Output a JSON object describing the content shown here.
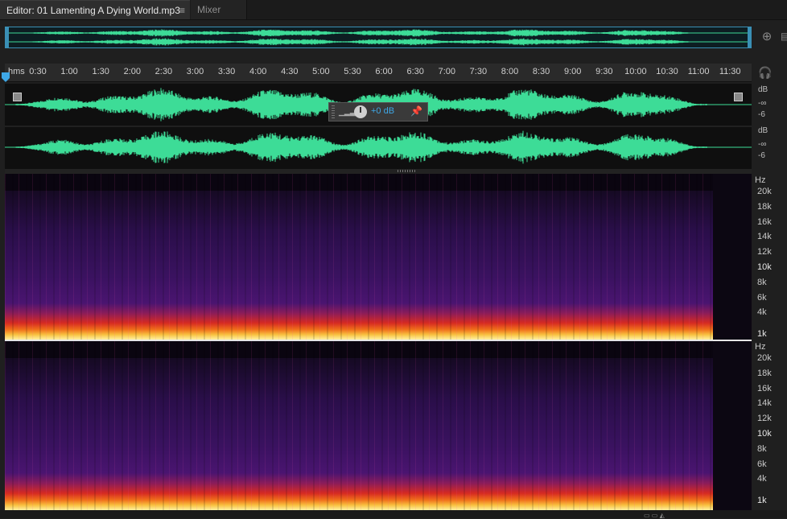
{
  "tabs": {
    "editor_label": "Editor: 01 Lamenting A Dying World.mp3",
    "editor_menu": "≡",
    "mixer_label": "Mixer"
  },
  "colors": {
    "waveform": "#3ddc97",
    "overview_border": "#3a8fb5",
    "accent": "#3ea7e6"
  },
  "icons": {
    "zoom": "zoom-icon",
    "headphones": "headphones-icon",
    "pin": "pin-icon"
  },
  "timeline": {
    "unit_label": "hms",
    "ticks": [
      "0:30",
      "1:00",
      "1:30",
      "2:00",
      "2:30",
      "3:00",
      "3:30",
      "4:00",
      "4:30",
      "5:00",
      "5:30",
      "6:00",
      "6:30",
      "7:00",
      "7:30",
      "8:00",
      "8:30",
      "9:00",
      "9:30",
      "10:00",
      "10:30",
      "11:00",
      "11:30"
    ]
  },
  "waveform": {
    "channel1": {
      "db_unit": "dB",
      "db_inf": "-∞",
      "db_minus6": "-6"
    },
    "channel2": {
      "db_unit": "dB",
      "db_inf": "-∞",
      "db_minus6": "-6"
    }
  },
  "hud": {
    "volume_value": "+0 dB"
  },
  "spectral": {
    "channel1": {
      "unit": "Hz",
      "labels": [
        "20k",
        "18k",
        "16k",
        "14k",
        "12k",
        "10k",
        "8k",
        "6k",
        "4k",
        "1k"
      ]
    },
    "channel2": {
      "unit": "Hz",
      "labels": [
        "20k",
        "18k",
        "16k",
        "14k",
        "12k",
        "10k",
        "8k",
        "6k",
        "4k",
        "1k"
      ]
    }
  }
}
